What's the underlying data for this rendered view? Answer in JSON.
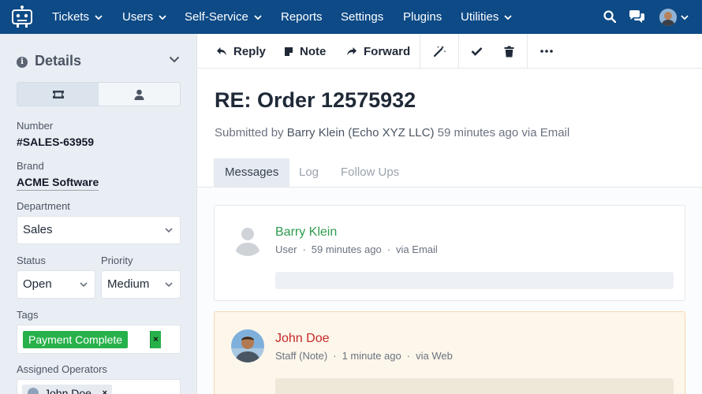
{
  "nav": {
    "items": [
      {
        "label": "Tickets",
        "has_dropdown": true
      },
      {
        "label": "Users",
        "has_dropdown": true
      },
      {
        "label": "Self-Service",
        "has_dropdown": true
      },
      {
        "label": "Reports",
        "has_dropdown": false
      },
      {
        "label": "Settings",
        "has_dropdown": false
      },
      {
        "label": "Plugins",
        "has_dropdown": false
      },
      {
        "label": "Utilities",
        "has_dropdown": true
      }
    ],
    "icons": [
      "search-icon",
      "chat-icon",
      "user-avatar"
    ],
    "color": "#0d4a86"
  },
  "sidebar": {
    "title": "Details",
    "number_label": "Number",
    "number": "#SALES-63959",
    "brand_label": "Brand",
    "brand": "ACME Software",
    "department_label": "Department",
    "department": "Sales",
    "status_label": "Status",
    "status": "Open",
    "priority_label": "Priority",
    "priority": "Medium",
    "tags_label": "Tags",
    "tags": [
      "Payment Complete"
    ],
    "tag_remove": "×",
    "operators_label": "Assigned Operators",
    "operators": [
      "John Doe"
    ],
    "operator_remove": "×"
  },
  "toolbar": {
    "reply": "Reply",
    "note": "Note",
    "forward": "Forward"
  },
  "ticket": {
    "title": "RE: Order 12575932",
    "submitted_prefix": "Submitted by",
    "submitter": "Barry Klein",
    "organisation": "(Echo XYZ LLC)",
    "submitted_suffix": "59 minutes ago via Email"
  },
  "tabs": [
    "Messages",
    "Log",
    "Follow Ups"
  ],
  "messages": [
    {
      "name": "Barry Klein",
      "role": "User",
      "time": "59 minutes ago",
      "via": "via Email",
      "name_color": "#2e9b4e"
    },
    {
      "name": "John Doe",
      "role": "Staff (Note)",
      "time": "1 minute ago",
      "via": "via Web",
      "name_color": "#c62828"
    }
  ],
  "colors": {
    "accent": "#0d4a86",
    "tag_green": "#27b14a",
    "staff_note_bg": "#fdf6ea"
  }
}
